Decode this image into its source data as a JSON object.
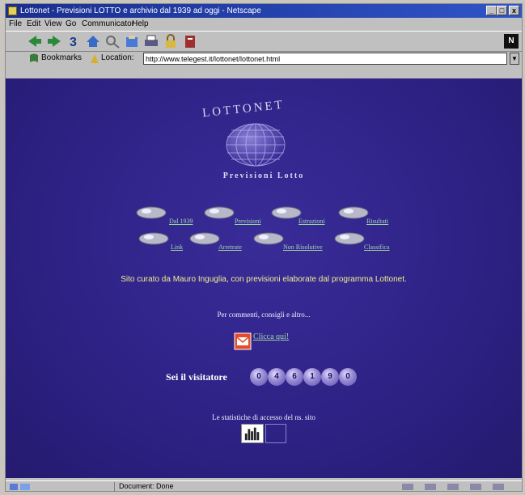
{
  "window": {
    "title": "Lottonet - Previsioni LOTTO e archivio dal 1939 ad oggi - Netscape",
    "controls": [
      "_",
      "□",
      "x"
    ]
  },
  "menu": [
    "File",
    "Edit",
    "View",
    "Go",
    "Communicator",
    "Help"
  ],
  "toolbar": {
    "icons": [
      "back-icon",
      "forward-icon",
      "reload-icon",
      "home-icon",
      "search-icon",
      "netscape-guide-icon",
      "print-icon",
      "security-icon",
      "stop-icon"
    ],
    "logo_letter": "N"
  },
  "location": {
    "bookmarks_label": "Bookmarks",
    "location_label": "Location:",
    "url": "http://www.telegest.it/lottonet/lottonet.html"
  },
  "page": {
    "logo_text": "LOTTONET",
    "logo_subtitle": "Previsioni Lotto",
    "nav_row1": [
      "Dal 1939",
      "Previsioni",
      "Estrazioni",
      "Risultati"
    ],
    "nav_row2": [
      "Link",
      "Arretrate",
      "Non Risolutive",
      "Classifica"
    ],
    "intro_text": "Sito curato da Mauro Inguglia, con previsioni elaborate dal programma Lottonet.",
    "contact_text": "Per commenti, consigli e altro...",
    "mail_link": "Clicca qui!",
    "visitor_label": "Sei il visitatore",
    "visitor_digits": [
      "0",
      "4",
      "6",
      "1",
      "9",
      "0"
    ],
    "stats_text": "Le statistiche di accesso del ns. sito"
  },
  "status": {
    "text": "Document: Done"
  }
}
